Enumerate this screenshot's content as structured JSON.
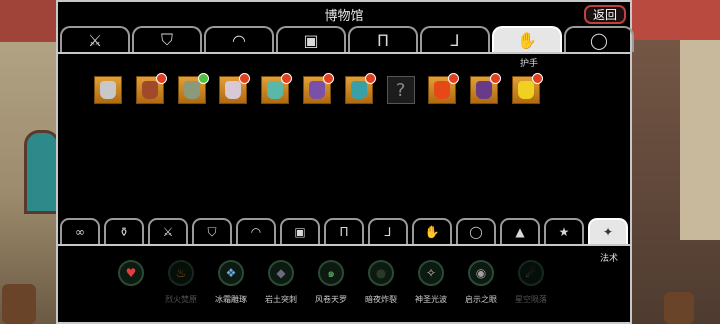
{
  "title": "博物馆",
  "back_label": "返回",
  "top_tabs": [
    {
      "icon": "sword-icon"
    },
    {
      "icon": "shield-icon"
    },
    {
      "icon": "helmet-icon"
    },
    {
      "icon": "armor-icon"
    },
    {
      "icon": "pants-icon"
    },
    {
      "icon": "boots-icon"
    },
    {
      "icon": "gauntlet-icon",
      "active": true
    },
    {
      "icon": "ring-icon"
    }
  ],
  "active_top_tab_label": "护手",
  "items": [
    {
      "color": "#c8c8c8",
      "badge": null
    },
    {
      "color": "#a04a2a",
      "badge": "red"
    },
    {
      "color": "#8a9a7a",
      "badge": "green"
    },
    {
      "color": "#d8c8d8",
      "badge": "red"
    },
    {
      "color": "#5ab8a8",
      "badge": "red"
    },
    {
      "color": "#7a50a8",
      "badge": "red"
    },
    {
      "color": "#3aa0a8",
      "badge": "red"
    },
    {
      "unknown": true,
      "text": "?"
    },
    {
      "color": "#e84818",
      "badge": "red"
    },
    {
      "color": "#6a3a8a",
      "badge": "red"
    },
    {
      "color": "#f0d020",
      "badge": "red"
    }
  ],
  "bottom_tabs": [
    {
      "icon": "infinity-icon"
    },
    {
      "icon": "potion-icon"
    },
    {
      "icon": "sword-icon"
    },
    {
      "icon": "shield-icon"
    },
    {
      "icon": "helmet-icon"
    },
    {
      "icon": "armor-icon"
    },
    {
      "icon": "pants-icon"
    },
    {
      "icon": "boots-icon"
    },
    {
      "icon": "gauntlet-icon"
    },
    {
      "icon": "ring-icon"
    },
    {
      "icon": "pile-icon"
    },
    {
      "icon": "star-icon"
    },
    {
      "icon": "wand-icon",
      "active": true
    }
  ],
  "active_bottom_tab_label": "法术",
  "spells": [
    {
      "label": "",
      "icon": "heart-icon",
      "color": "#e04040",
      "dim": false
    },
    {
      "label": "烈火焚原",
      "icon": "fire-icon",
      "color": "#e09020",
      "dim": true
    },
    {
      "label": "冰霜雕琢",
      "icon": "ice-icon",
      "color": "#6aa8e0",
      "dim": false
    },
    {
      "label": "岩土突刺",
      "icon": "rock-icon",
      "color": "#6a6a7a",
      "dim": false
    },
    {
      "label": "风卷天罗",
      "icon": "wind-icon",
      "color": "#60b060",
      "dim": false
    },
    {
      "label": "暗夜炸裂",
      "icon": "dark-icon",
      "color": "#2a3a2a",
      "dim": false
    },
    {
      "label": "神圣光波",
      "icon": "holy-icon",
      "color": "#c0c0c0",
      "dim": false
    },
    {
      "label": "启示之眼",
      "icon": "eye-icon",
      "color": "#a0a0a0",
      "dim": false
    },
    {
      "label": "星空陨落",
      "icon": "meteor-icon",
      "color": "#909090",
      "dim": true
    }
  ]
}
